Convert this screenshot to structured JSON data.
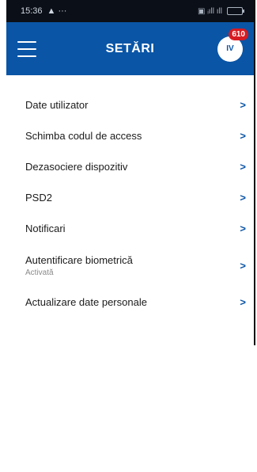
{
  "status_bar": {
    "time": "15:36",
    "icons_left": "▲ ···",
    "icons_right": "▣ ᵢıll ıll"
  },
  "header": {
    "title": "SETĂRI",
    "avatar_initials": "IV",
    "badge_count": "610"
  },
  "settings": [
    {
      "label": "Date utilizator",
      "sub": ""
    },
    {
      "label": "Schimba codul de access",
      "sub": ""
    },
    {
      "label": "Dezasociere dispozitiv",
      "sub": ""
    },
    {
      "label": "PSD2",
      "sub": ""
    },
    {
      "label": "Notificari",
      "sub": ""
    },
    {
      "label": "Autentificare biometrică",
      "sub": "Activată"
    },
    {
      "label": "Actualizare date personale",
      "sub": ""
    }
  ],
  "colors": {
    "header": "#0a55a6",
    "accent": "#0a55a6",
    "badge": "#d71b22"
  }
}
